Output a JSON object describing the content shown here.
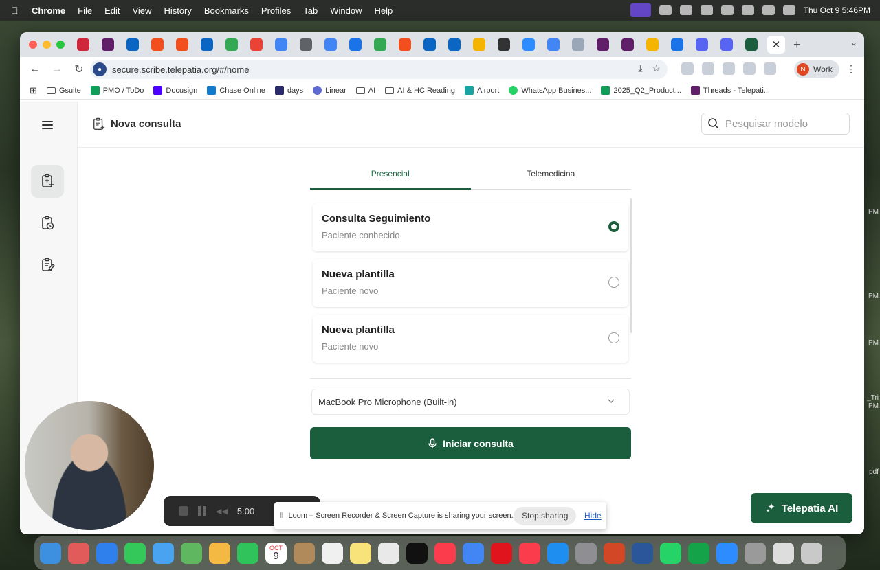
{
  "menubar": {
    "app": "Chrome",
    "items": [
      "File",
      "Edit",
      "View",
      "History",
      "Bookmarks",
      "Profiles",
      "Tab",
      "Window",
      "Help"
    ],
    "clock": "Thu Oct 9  5:46PM"
  },
  "browser": {
    "url": "secure.scribe.telepatia.org/#/home",
    "profile_initial": "N",
    "profile_name": "Work"
  },
  "bookmarks": [
    "Gsuite",
    "PMO / ToDo",
    "Docusign",
    "Chase Online",
    "days",
    "Linear",
    "AI",
    "AI & HC Reading",
    "Airport",
    "WhatsApp Busines...",
    "2025_Q2_Product...",
    "Threads - Telepati..."
  ],
  "app": {
    "page_title": "Nova consulta",
    "search_placeholder": "Pesquisar modelo",
    "tabs": [
      {
        "label": "Presencial",
        "active": true
      },
      {
        "label": "Telemedicina",
        "active": false
      }
    ],
    "templates": [
      {
        "title": "Consulta Seguimiento",
        "subtitle": "Paciente conhecido",
        "selected": true
      },
      {
        "title": "Nueva plantilla",
        "subtitle": "Paciente novo",
        "selected": false
      },
      {
        "title": "Nueva plantilla",
        "subtitle": "Paciente novo",
        "selected": false
      }
    ],
    "microphone": "MacBook Pro Microphone (Built-in)",
    "start_button": "Iniciar consulta",
    "assistant_button": "Telepatia AI"
  },
  "loom": {
    "timer": "5:00",
    "share_message": "Loom – Screen Recorder & Screen Capture is sharing your screen.",
    "stop_label": "Stop sharing",
    "hide_label": "Hide"
  },
  "dock": {
    "calendar_month": "OCT",
    "calendar_day": "9"
  },
  "desktop_side_labels": [
    "PM",
    "PM",
    "PM",
    "_Tri",
    "PM",
    "pdf"
  ],
  "colors": {
    "brand_green": "#1b5e3d",
    "accent_text": "#1f6e4a"
  }
}
